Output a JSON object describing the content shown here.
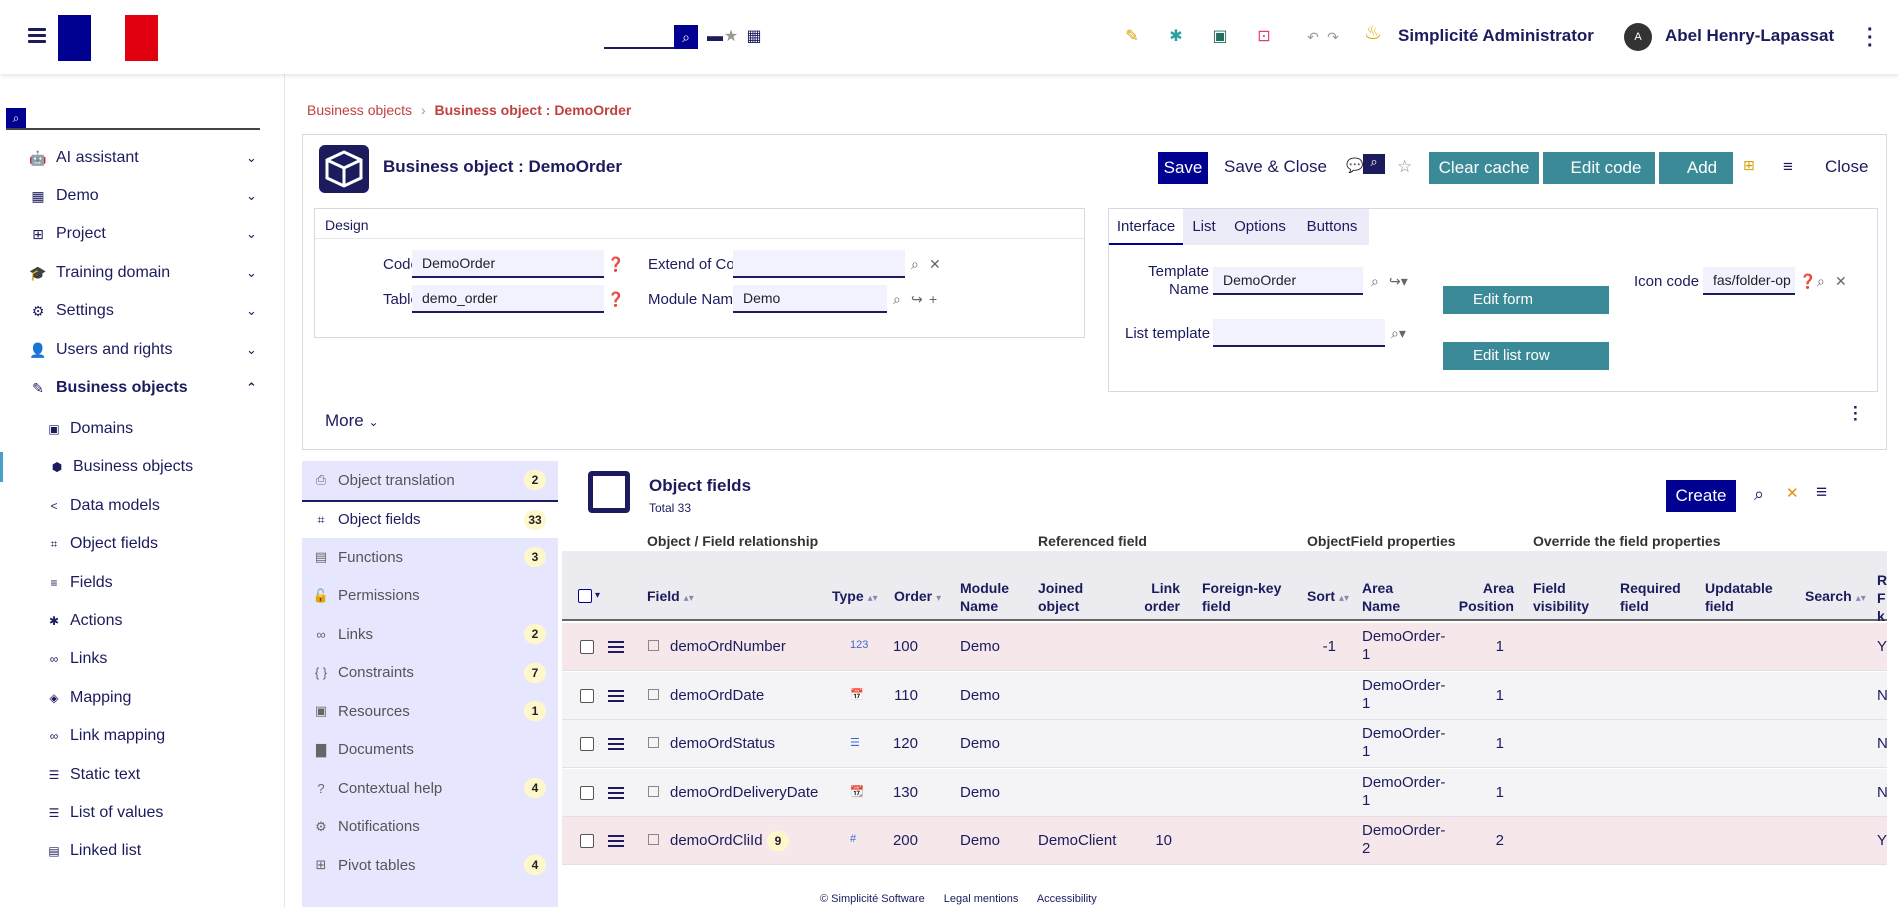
{
  "header": {
    "user_role": "Simplicité Administrator",
    "user_name": "Abel Henry-Lapassat",
    "avatar_initial": "A"
  },
  "sidebar": {
    "items": [
      {
        "label": "AI assistant",
        "icon": "robot-icon",
        "glyph": "🤖"
      },
      {
        "label": "Demo",
        "icon": "demo-app-icon",
        "glyph": "▦"
      },
      {
        "label": "Project",
        "icon": "project-tree-icon",
        "glyph": "⊞"
      },
      {
        "label": "Training domain",
        "icon": "graduation-cap-icon",
        "glyph": "🎓"
      },
      {
        "label": "Settings",
        "icon": "gear-icon",
        "glyph": "⚙"
      },
      {
        "label": "Users and rights",
        "icon": "users-lock-icon",
        "glyph": "👤"
      },
      {
        "label": "Business objects",
        "icon": "tools-icon",
        "glyph": "✎"
      }
    ],
    "sub_items": [
      {
        "label": "Domains",
        "icon": "book-icon",
        "glyph": "▣"
      },
      {
        "label": "Business objects",
        "icon": "cube-icon",
        "glyph": "⬢"
      },
      {
        "label": "Data models",
        "icon": "share-nodes-icon",
        "glyph": "<"
      },
      {
        "label": "Object fields",
        "icon": "object-field-icon",
        "glyph": "⌗"
      },
      {
        "label": "Fields",
        "icon": "list-lines-icon",
        "glyph": "≡"
      },
      {
        "label": "Actions",
        "icon": "gear-small-icon",
        "glyph": "✱"
      },
      {
        "label": "Links",
        "icon": "link-icon",
        "glyph": "∞"
      },
      {
        "label": "Mapping",
        "icon": "layers-icon",
        "glyph": "◈"
      },
      {
        "label": "Link mapping",
        "icon": "chain-icon",
        "glyph": "∞"
      },
      {
        "label": "Static text",
        "icon": "list-icon",
        "glyph": "☰"
      },
      {
        "label": "List of values",
        "icon": "list-values-icon",
        "glyph": "☰"
      },
      {
        "label": "Linked list",
        "icon": "linked-list-icon",
        "glyph": "▤"
      }
    ]
  },
  "breadcrumb": {
    "parent": "Business objects",
    "current": "Business object : DemoOrder"
  },
  "form": {
    "title": "Business object : DemoOrder",
    "save": "Save",
    "save_close": "Save & Close",
    "clear_cache": "Clear cache",
    "edit_code": "Edit code",
    "add": "Add",
    "close": "Close",
    "design_label": "Design",
    "code_label": "Code",
    "code_value": "DemoOrder",
    "table_label": "Table",
    "table_value": "demo_order",
    "extend_label": "Extend of Code",
    "extend_value": "",
    "module_label": "Module Name",
    "module_value": "Demo",
    "required_mark": "*",
    "more": "More"
  },
  "tabs": {
    "items": [
      "Interface",
      "List",
      "Options",
      "Buttons"
    ],
    "template_label_1": "Template",
    "template_label_2": "Name",
    "template_value": "DemoOrder",
    "list_template_label": "List template",
    "list_template_value": "",
    "edit_form": "Edit form",
    "edit_list_row": "Edit list row",
    "icon_code_label": "Icon code",
    "icon_code_value": "fas/folder-op"
  },
  "left_panel": {
    "items": [
      {
        "label": "Object translation",
        "badge": "2",
        "icon": "translate-icon",
        "glyph": "⎙"
      },
      {
        "label": "Object fields",
        "badge": "33",
        "icon": "object-field-icon",
        "glyph": "⌗"
      },
      {
        "label": "Functions",
        "badge": "3",
        "icon": "functions-icon",
        "glyph": "▤"
      },
      {
        "label": "Permissions",
        "badge": "",
        "icon": "lock-open-icon",
        "glyph": "🔓"
      },
      {
        "label": "Links",
        "badge": "2",
        "icon": "link-icon",
        "glyph": "∞"
      },
      {
        "label": "Constraints",
        "badge": "7",
        "icon": "braces-icon",
        "glyph": "{ }"
      },
      {
        "label": "Resources",
        "badge": "1",
        "icon": "resource-icon",
        "glyph": "▣"
      },
      {
        "label": "Documents",
        "badge": "",
        "icon": "document-icon",
        "glyph": "▇"
      },
      {
        "label": "Contextual help",
        "badge": "4",
        "icon": "help-icon",
        "glyph": "?"
      },
      {
        "label": "Notifications",
        "badge": "",
        "icon": "gear-icon",
        "glyph": "⚙"
      },
      {
        "label": "Pivot tables",
        "badge": "4",
        "icon": "table-icon",
        "glyph": "⊞"
      }
    ]
  },
  "object_fields": {
    "title": "Object fields",
    "total": "Total 33",
    "create": "Create",
    "groups": [
      "Object / Field relationship",
      "Referenced field",
      "ObjectField properties",
      "Override the field properties"
    ],
    "columns": [
      "Field",
      "Type",
      "Order",
      "Module Name",
      "Joined object",
      "Link order",
      "Foreign-key field",
      "Sort",
      "Area Name",
      "Area Position",
      "Field visibility",
      "Required field",
      "Updatable field",
      "Search"
    ],
    "rows": [
      {
        "field": "demoOrdNumber",
        "type_icon": "123",
        "order": "100",
        "module": "Demo",
        "joined": "",
        "link_order": "",
        "fk": "",
        "sort": "-1",
        "area_1": "DemoOrder-",
        "area_2": "1",
        "area_pos": "1",
        "tail": "Y"
      },
      {
        "field": "demoOrdDate",
        "type_icon": "📅",
        "order": "110",
        "module": "Demo",
        "joined": "",
        "link_order": "",
        "fk": "",
        "sort": "",
        "area_1": "DemoOrder-",
        "area_2": "1",
        "area_pos": "1",
        "tail": "N"
      },
      {
        "field": "demoOrdStatus",
        "type_icon": "☰",
        "order": "120",
        "module": "Demo",
        "joined": "",
        "link_order": "",
        "fk": "",
        "sort": "",
        "area_1": "DemoOrder-",
        "area_2": "1",
        "area_pos": "1",
        "tail": "N"
      },
      {
        "field": "demoOrdDeliveryDate",
        "type_icon": "📆",
        "order": "130",
        "module": "Demo",
        "joined": "",
        "link_order": "",
        "fk": "",
        "sort": "",
        "area_1": "DemoOrder-",
        "area_2": "1",
        "area_pos": "1",
        "tail": "N"
      },
      {
        "field": "demoOrdCliId",
        "type_icon": "#",
        "order": "200",
        "module": "Demo",
        "joined": "DemoClient",
        "link_order": "10",
        "fk": "",
        "sort": "",
        "area_1": "DemoOrder-",
        "area_2": "2",
        "area_pos": "2",
        "tail": "Y",
        "count": "9"
      }
    ]
  },
  "footer": {
    "copyright": "© Simplicité Software",
    "legal": "Legal mentions",
    "accessibility": "Accessibility"
  },
  "colors": {
    "primary": "#000091",
    "teal": "#3a8a97",
    "navy_text": "#1b1b5e",
    "crumb_red": "#c04040"
  }
}
